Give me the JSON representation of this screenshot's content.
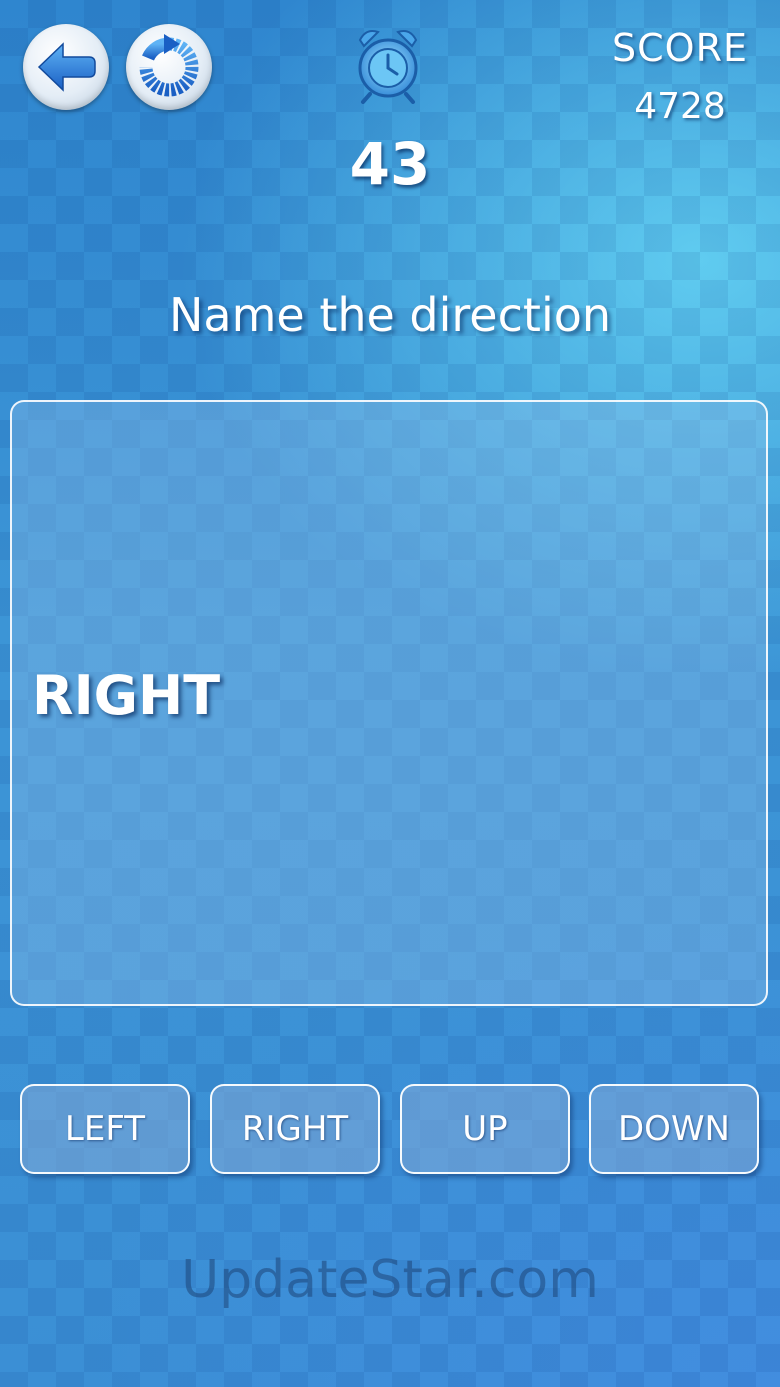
{
  "header": {
    "back_icon": "back-arrow-icon",
    "restart_icon": "restart-icon",
    "timer_icon": "alarm-clock-icon",
    "timer_value": "43",
    "score_label": "SCORE",
    "score_value": "4728"
  },
  "game": {
    "prompt": "Name the direction",
    "word": "RIGHT"
  },
  "answers": {
    "left": "LEFT",
    "right": "RIGHT",
    "up": "UP",
    "down": "DOWN"
  },
  "watermark": "UpdateStar.com",
  "colors": {
    "background": "#3b8fd5",
    "accent": "#1e6fcf",
    "text": "#ffffff"
  }
}
